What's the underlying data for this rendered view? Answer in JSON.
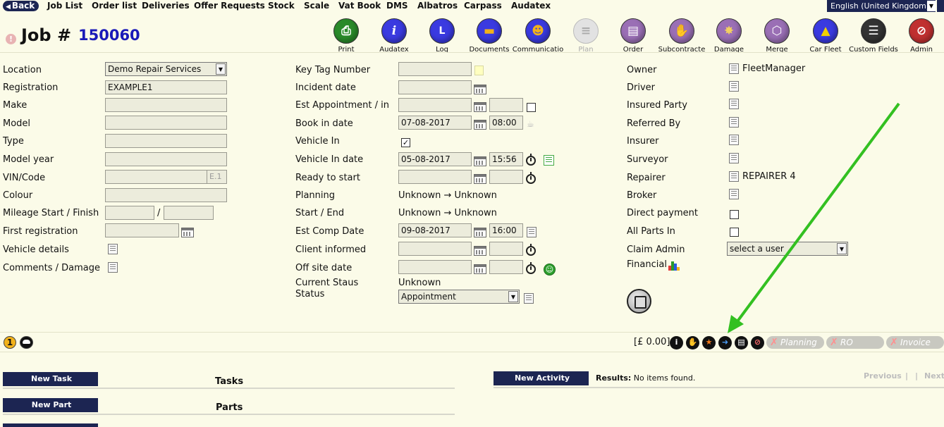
{
  "nav": {
    "back": "Back",
    "items": [
      "Job List",
      "Order list",
      "Deliveries",
      "Offer Requests",
      "Stock",
      "Scale",
      "Vat Book",
      "DMS",
      "Albatros",
      "Carpass",
      "Audatex"
    ],
    "language": "English (United Kingdom)"
  },
  "header": {
    "job_label": "Job #",
    "job_number": "150060"
  },
  "toolbar": [
    {
      "label": "Print",
      "icon": "print-icon",
      "color": "#2a8a2a"
    },
    {
      "label": "Audatex",
      "icon": "info-icon",
      "color": "#3a3ae0"
    },
    {
      "label": "Log",
      "icon": "log-icon",
      "color": "#3a3ae0"
    },
    {
      "label": "Documents",
      "icon": "folder-icon",
      "color": "#3a3ae0"
    },
    {
      "label": "Communicatio",
      "icon": "chat-icon",
      "color": "#3a3ae0"
    },
    {
      "label": "Plan",
      "icon": "plan-icon",
      "color": "#d8d8d8",
      "disabled": true
    },
    {
      "label": "Order",
      "icon": "order-icon",
      "color": "#9a6fb5"
    },
    {
      "label": "Subcontracte",
      "icon": "handshake-icon",
      "color": "#9a6fb5"
    },
    {
      "label": "Damage",
      "icon": "damage-icon",
      "color": "#9a6fb5"
    },
    {
      "label": "Merge",
      "icon": "merge-icon",
      "color": "#9a6fb5"
    },
    {
      "label": "Car Fleet",
      "icon": "car-icon",
      "color": "#3a3ae0"
    },
    {
      "label": "Custom Fields",
      "icon": "list-icon",
      "color": "#333333"
    },
    {
      "label": "Admin",
      "icon": "admin-icon",
      "color": "#c03030"
    }
  ],
  "left": {
    "location_label": "Location",
    "location_value": "Demo Repair Services",
    "registration_label": "Registration",
    "registration_value": "EXAMPLE1",
    "make_label": "Make",
    "model_label": "Model",
    "type_label": "Type",
    "model_year_label": "Model year",
    "vin_label": "VIN/Code",
    "vin_suffix": "E.1",
    "colour_label": "Colour",
    "mileage_label": "Mileage Start / Finish",
    "mileage_sep": "/",
    "first_reg_label": "First registration",
    "vehicle_details_label": "Vehicle details",
    "comments_label": "Comments / Damage"
  },
  "middle": {
    "key_tag_label": "Key Tag Number",
    "incident_label": "Incident date",
    "est_appt_label": "Est Appointment / in",
    "book_in_label": "Book in date",
    "book_in_date": "07-08-2017",
    "book_in_time": "08:00",
    "vehicle_in_label": "Vehicle In",
    "vehicle_in_checked": "✓",
    "vehicle_in_date_label": "Vehicle In date",
    "vehicle_in_date": "05-08-2017",
    "vehicle_in_time": "15:56",
    "ready_label": "Ready to start",
    "planning_label": "Planning",
    "planning_value": "Unknown → Unknown",
    "start_end_label": "Start / End",
    "start_end_value": "Unknown → Unknown",
    "est_comp_label": "Est Comp Date",
    "est_comp_date": "09-08-2017",
    "est_comp_time": "16:00",
    "client_informed_label": "Client informed",
    "off_site_label": "Off site date",
    "current_staus_label": "Current Staus",
    "current_staus_value": "Unknown",
    "status_label": "Status",
    "status_value": "Appointment"
  },
  "right": {
    "owner_label": "Owner",
    "owner_value": "FleetManager",
    "driver_label": "Driver",
    "insured_label": "Insured Party",
    "referred_label": "Referred By",
    "insurer_label": "Insurer",
    "surveyor_label": "Surveyor",
    "repairer_label": "Repairer",
    "repairer_value": "REPAIRER 4",
    "broker_label": "Broker",
    "direct_payment_label": "Direct payment",
    "all_parts_label": "All Parts In",
    "claim_admin_label": "Claim Admin",
    "claim_admin_value": "select a user",
    "financial_label": "Financial"
  },
  "status_strip": {
    "badge": "1",
    "amount": "[£ 0.00]",
    "pills": [
      "Planning",
      "RO",
      "Invoice"
    ]
  },
  "sections": {
    "new_task": "New Task",
    "tasks": "Tasks",
    "new_part": "New Part",
    "parts": "Parts",
    "new_activity": "New Activity",
    "results_label": "Results:",
    "results_text": "No items found.",
    "previous": "Previous",
    "next": "Next",
    "sep": "|"
  },
  "colors": {
    "background": "#fbfbe8",
    "nav_dark": "#1c2552",
    "job_number": "#1a1ab8",
    "arrow": "#33c021"
  }
}
